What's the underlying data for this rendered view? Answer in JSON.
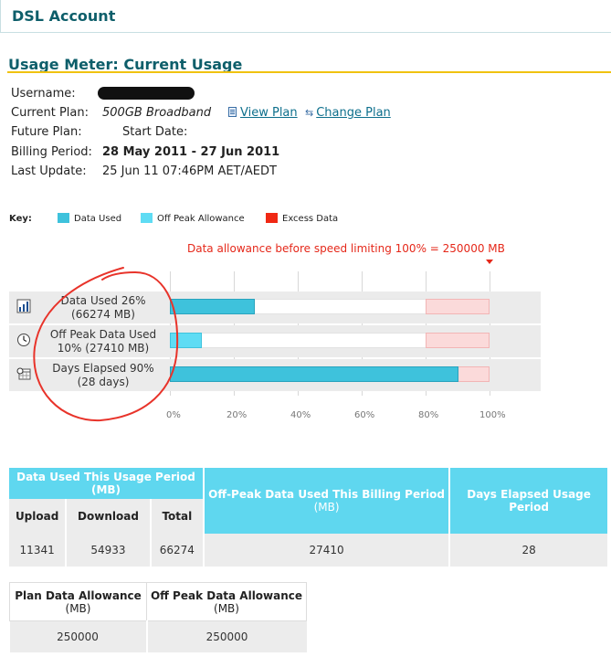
{
  "header": {
    "account_title": "DSL Account"
  },
  "section": {
    "title": "Usage Meter: Current Usage"
  },
  "details": {
    "username_label": "Username:",
    "current_plan_label": "Current Plan:",
    "current_plan_value": "500GB Broadband",
    "view_plan_link": "View Plan",
    "change_plan_link": "Change Plan",
    "future_plan_label": "Future Plan:",
    "start_date_label": "Start Date:",
    "billing_period_label": "Billing Period:",
    "billing_period_value": "28 May 2011 - 27 Jun 2011",
    "last_update_label": "Last Update:",
    "last_update_value": "25 Jun 11 07:46PM AET/AEDT"
  },
  "key": {
    "label": "Key:",
    "items": [
      {
        "label": "Data Used",
        "color": "#3ec2dc"
      },
      {
        "label": "Off Peak Allowance",
        "color": "#5fdcf4"
      },
      {
        "label": "Excess Data",
        "color": "#f02814"
      }
    ]
  },
  "meter": {
    "allowance_note": "Data allowance before speed limiting 100% = 250000 MB",
    "rows": [
      {
        "line1": "Data Used 26%",
        "line2": "(66274 MB)",
        "percent": 26.5,
        "icon": "bar-chart-icon"
      },
      {
        "line1": "Off Peak Data Used",
        "line2": "10% (27410 MB)",
        "percent": 10.0,
        "icon": "clock-icon"
      },
      {
        "line1": "Days Elapsed 90%",
        "line2": "(28 days)",
        "percent": 90.3,
        "icon": "calendar-icon"
      }
    ],
    "ticks": [
      "0%",
      "20%",
      "40%",
      "60%",
      "80%",
      "100%"
    ],
    "excess_threshold_percent": 80
  },
  "usage_table": {
    "group_header": "Data Used This Usage Period (MB)",
    "offpeak_header": "Off-Peak Data Used This Billing Period",
    "offpeak_unit": "(MB)",
    "days_header": "Days Elapsed Usage Period",
    "col_upload": "Upload",
    "col_download": "Download",
    "col_total": "Total",
    "upload": "11341",
    "download": "54933",
    "total": "66274",
    "offpeak": "27410",
    "days": "28"
  },
  "allowance_table": {
    "plan_header": "Plan Data Allowance",
    "plan_unit": "(MB)",
    "offpeak_header": "Off Peak Data Allowance",
    "offpeak_unit": "(MB)",
    "plan_value": "250000",
    "offpeak_value": "250000"
  }
}
